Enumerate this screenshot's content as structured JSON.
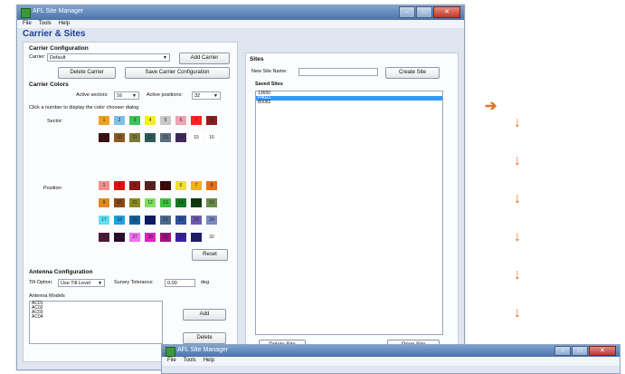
{
  "window": {
    "title": "AFL Site Manager",
    "controls": [
      "–",
      "□",
      "✕"
    ],
    "menu": [
      "File",
      "Tools",
      "Help"
    ],
    "page_title": "Carrier & Sites"
  },
  "carrier_config": {
    "heading": "Carrier Configuration",
    "carrier_label": "Carrier:",
    "carrier_value": "Default",
    "add_button": "Add Carrier",
    "delete_button": "Delete Carrier",
    "save_button": "Save Carrier Configuration"
  },
  "carrier_colors": {
    "heading": "Carrier Colors",
    "active_sectors_label": "Active sectors:",
    "active_sectors_value": "16",
    "active_positions_label": "Active positions:",
    "active_positions_value": "32",
    "hint": "Click a number to display the color chooser dialog",
    "sector_label": "Sector:",
    "position_label": "Position:",
    "sector_swatches": [
      {
        "n": "1",
        "c": "#f0a020"
      },
      {
        "n": "2",
        "c": "#7fbfe8"
      },
      {
        "n": "3",
        "c": "#3cc35a"
      },
      {
        "n": "4",
        "c": "#f3ef22"
      },
      {
        "n": "5",
        "c": "#c8c8c8"
      },
      {
        "n": "6",
        "c": "#f2a0b4"
      },
      {
        "n": "7",
        "c": "#ff2020"
      },
      {
        "n": "8",
        "c": "#8a1f1f"
      },
      {
        "n": "9",
        "c": "#3a0f0f"
      },
      {
        "n": "10",
        "c": "#8a5a22"
      },
      {
        "n": "11",
        "c": "#7a7a3a"
      },
      {
        "n": "12",
        "c": "#2f5a5a"
      },
      {
        "n": "13",
        "c": "#5c6f7f"
      },
      {
        "n": "14",
        "c": "#3f2a5a"
      },
      {
        "n": "15",
        "c": "#ffffff"
      },
      {
        "n": "16",
        "c": "#ffffff"
      }
    ],
    "position_swatches": [
      {
        "n": "1",
        "c": "#f09088"
      },
      {
        "n": "2",
        "c": "#e01010"
      },
      {
        "n": "3",
        "c": "#8a1a1a"
      },
      {
        "n": "4",
        "c": "#5a2020"
      },
      {
        "n": "5",
        "c": "#3a0a0a"
      },
      {
        "n": "6",
        "c": "#f2e030"
      },
      {
        "n": "7",
        "c": "#f0b020"
      },
      {
        "n": "8",
        "c": "#e07020"
      },
      {
        "n": "9",
        "c": "#e08a20"
      },
      {
        "n": "10",
        "c": "#8a4a12"
      },
      {
        "n": "11",
        "c": "#8a8a20"
      },
      {
        "n": "12",
        "c": "#80e060"
      },
      {
        "n": "13",
        "c": "#40c040"
      },
      {
        "n": "14",
        "c": "#107a20"
      },
      {
        "n": "15",
        "c": "#0a3a0a"
      },
      {
        "n": "16",
        "c": "#6a8a4a"
      },
      {
        "n": "17",
        "c": "#60e0f0"
      },
      {
        "n": "18",
        "c": "#20a0e0"
      },
      {
        "n": "19",
        "c": "#1060a0"
      },
      {
        "n": "20",
        "c": "#0a1a6a"
      },
      {
        "n": "21",
        "c": "#4a6a8a"
      },
      {
        "n": "22",
        "c": "#3050a0"
      },
      {
        "n": "23",
        "c": "#6a5ab0"
      },
      {
        "n": "24",
        "c": "#7a8ac0"
      },
      {
        "n": "25",
        "c": "#4a1a3a"
      },
      {
        "n": "26",
        "c": "#2a0a2a"
      },
      {
        "n": "27",
        "c": "#f070f0"
      },
      {
        "n": "28",
        "c": "#e020c0"
      },
      {
        "n": "29",
        "c": "#a01080"
      },
      {
        "n": "30",
        "c": "#3a20a0"
      },
      {
        "n": "31",
        "c": "#201a6a"
      },
      {
        "n": "32",
        "c": "#ffffff"
      }
    ],
    "reset_button": "Reset"
  },
  "antenna_config": {
    "heading": "Antenna Configuration",
    "tilt_label": "Tilt Option:",
    "tilt_value": "Use Tilt Level",
    "tolerance_label": "Survey Tolerance:",
    "tolerance_value": "0.00",
    "tolerance_unit": "deg",
    "models_label": "Antenna Models",
    "models": [
      "AC01",
      "AC02",
      "AC03",
      "AC04"
    ],
    "add_button": "Add",
    "delete_button": "Delete"
  },
  "sites": {
    "heading": "Sites",
    "new_site_label": "New Site Name:",
    "new_site_value": "",
    "create_button": "Create Site",
    "saved_heading": "Saved Sites",
    "saved_sites": [
      "13650",
      "P4021",
      "B0082"
    ],
    "selected_index": 1,
    "delete_button": "Delete Site",
    "open_button": "Open Site"
  },
  "annotations": {
    "right_arrow": "➔",
    "down_arrow": "↓",
    "arrow_color": "#e2722a"
  },
  "second_window": {
    "title": "AFL Site Manager",
    "menu": [
      "File",
      "Tools",
      "Help"
    ]
  }
}
